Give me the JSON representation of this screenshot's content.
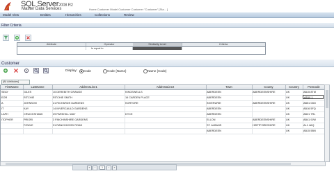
{
  "app": {
    "brand_main": "SQL Server",
    "brand_version": "2008 R2",
    "brand_sub": "Master Data Services",
    "breadcrumb": "Home  Customer Model  Customer  Customer  \"Customer\" [Sta... ]"
  },
  "nav": [
    "Model View",
    "Entities",
    "Hierarchies",
    "Collections",
    "Review"
  ],
  "filter": {
    "title": "Filter Criteria",
    "columns": [
      "Attribute",
      "Operator",
      "Similarity Level",
      "Criteria"
    ],
    "row": {
      "attribute": "",
      "operator": "Is equal to",
      "similarity": "",
      "criteria": ""
    }
  },
  "customer": {
    "title": "Customer",
    "display_label": "Display:",
    "display_options": [
      "Code",
      "Code {Name}",
      "Name {Code}"
    ],
    "display_selected": "Code",
    "filter_tag": "[All Attributes]"
  },
  "grid": {
    "columns": [
      "FirstName",
      "LastName",
      "AddressLine1",
      "AddressLine2",
      "Town",
      "County",
      "Country",
      "Postcode"
    ],
    "rows": [
      [
        "SEAY",
        "GILES",
        "10 DEREBITH GRANGE",
        "KINGSWELLS",
        "ABERDEEN",
        "ABERDEENSHIRE",
        "UK",
        "AB15 8TM"
      ],
      [
        "EOR",
        "RITCHIE",
        "RITCHIE SMITH",
        "16 CARDEN PLACE",
        "ABERDEEN",
        "",
        "UK",
        "AB10 1"
      ],
      [
        "A",
        "JOHNSON",
        "21 RICHARDS GARDENS",
        "KORTORE",
        "INVERURIE",
        "ABERDEENSHIRE",
        "UK",
        "AB51 0DD"
      ],
      [
        "IT",
        "KAY",
        "14 INVERCAULD GARDENS",
        "",
        "ABERDEEN",
        "",
        "UK",
        "AB16 5FQ"
      ],
      [
        "LAPH",
        "CRUICKSHANK",
        "29 PARKHILL WAY",
        "DYCE",
        "ABERDEEN",
        "",
        "UK",
        "AB21 7RL"
      ],
      [
        "ITOPHER",
        "PRIORI",
        "3 FINCHINSHIRE GARDENS",
        "",
        "ELLON",
        "ABERDEENSHIRE",
        "UK",
        "AB41 9JW"
      ],
      [
        "",
        "FOWLE",
        "91 RANCHHOOD ROAD",
        "",
        "ST. ALBANS",
        "HERTFORDSHIRE",
        "UK",
        "AL1 4AQ"
      ],
      [
        "",
        "",
        "",
        "",
        "ABERDEEN",
        "",
        "UK",
        "AB15 5BN"
      ]
    ]
  },
  "pager": {
    "page": "1"
  }
}
